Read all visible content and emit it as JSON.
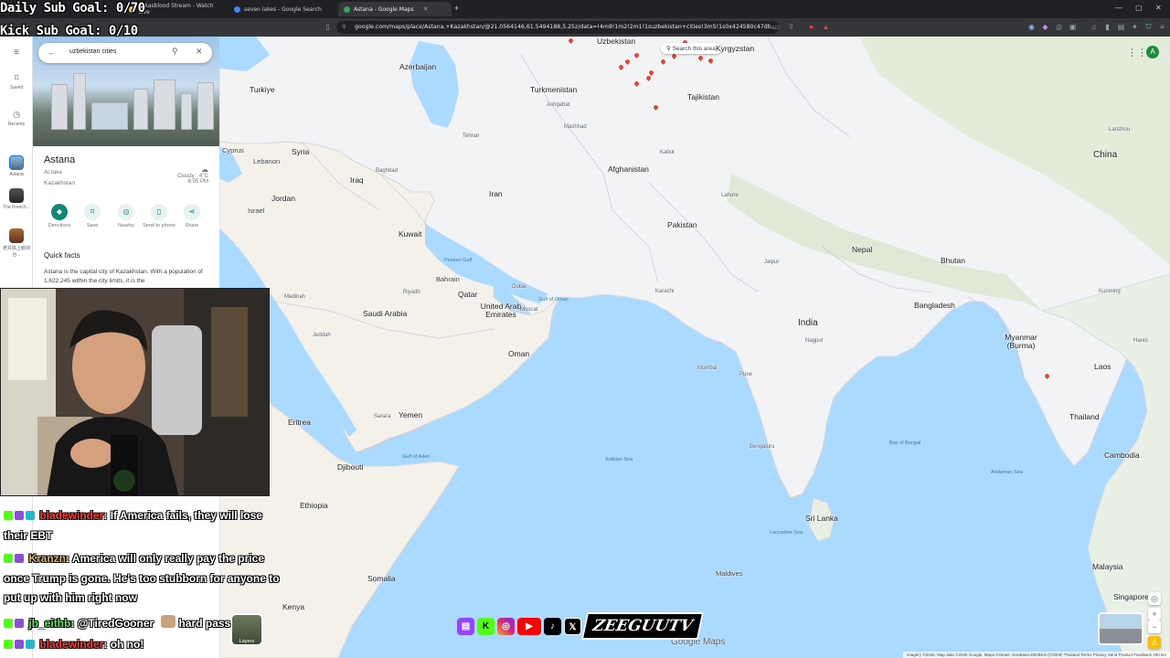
{
  "overlay": {
    "daily_goal": "Daily Sub Goal: 0/70",
    "kick_goal": "Kick Sub Goal: 0/10"
  },
  "browser": {
    "tabs": [
      {
        "label": "sukasblood Stream - Watch Live",
        "favicon": "#e9c34a"
      },
      {
        "label": "seven lakes - Google Search",
        "favicon": "#4285f4"
      },
      {
        "label": "Astana - Google Maps",
        "favicon": "#34a853",
        "active": true
      }
    ],
    "new_tab": "+",
    "url": "google.com/maps/place/Astana,+Kazakhstan/@21.0564146,61.5494188,5.25z/data=!4m9!1m2!2m1!1suzbekistan+cities!3m5!1s0x424580c47db..."
  },
  "rail": {
    "menu": "≡",
    "items": [
      {
        "label": "Saved",
        "icon": "bookmark-icon"
      },
      {
        "label": "Recents",
        "icon": "history-icon"
      },
      {
        "label": "Astana",
        "icon": "astana-thumb"
      },
      {
        "label": "The French...",
        "icon": "french-thumb"
      },
      {
        "label": "老井陈上鹅圳 台...",
        "icon": "recent-thumb"
      }
    ]
  },
  "search": {
    "query": "uzbekistan cities"
  },
  "place": {
    "title": "Astana",
    "native_name": "Астана",
    "country": "Kazakhstan",
    "weather_desc": "Cloudy · 4°C",
    "weather_time": "6:05 PM",
    "actions": [
      {
        "label": "Directions",
        "icon": "directions-icon"
      },
      {
        "label": "Save",
        "icon": "bookmark-icon"
      },
      {
        "label": "Nearby",
        "icon": "nearby-icon"
      },
      {
        "label": "Send to phone",
        "icon": "phone-icon"
      },
      {
        "label": "Share",
        "icon": "share-icon"
      }
    ],
    "quick_facts_title": "Quick facts",
    "quick_facts_text": "Astana is the capital city of Kazakhstan. With a population of 1,622,245 within the city limits, it is the"
  },
  "map": {
    "search_this_area": "Search this area",
    "google_logo": "Google Maps",
    "footer": "Imagery ©2026, Map data ©2026 Google, Mapa GISrael, GeoBasis-DE/BKG (©2009)   Thailand   Terms   Privacy   Send Product Feedback   200 km",
    "layers_label": "Layers",
    "account_initial": "A",
    "labels": {
      "uzbekistan": "Uzbekistan",
      "kyrgyzstan": "Kyrgyzstan",
      "azerbaijan": "Azerbaijan",
      "turkiye": "Turkiye",
      "turkmenistan": "Turkmenistan",
      "ashgabat": "Ashgabat",
      "tajikistan": "Tajikistan",
      "tehran": "Tehran",
      "mashhad": "Mashhad",
      "cyprus": "Cyprus",
      "syria": "Syria",
      "lebanon": "Lebanon",
      "baghdad": "Baghdad",
      "iraq": "Iraq",
      "afghanistan": "Afghanistan",
      "kabul": "Kabul",
      "jordan": "Jordan",
      "israel": "Israel",
      "iran": "Iran",
      "pakistan": "Pakistan",
      "kuwait": "Kuwait",
      "nepal": "Nepal",
      "bhutan": "Bhutan",
      "china": "China",
      "bahrain": "Bahrain",
      "qatar": "Qatar",
      "dubai": "Dubai",
      "riyadh": "Riyadh",
      "madinah": "Madinah",
      "karachi": "Karachi",
      "bangladesh": "Bangladesh",
      "saudi_arabia": "Saudi Arabia",
      "uae": "United Arab Emirates",
      "muscat": "Muscat",
      "india": "India",
      "myanmar": "Myanmar (Burma)",
      "jeddah": "Jeddah",
      "oman": "Oman",
      "laos": "Laos",
      "mumbai": "Mumbai",
      "pune": "Pune",
      "thailand": "Thailand",
      "eritrea": "Eritrea",
      "sanaa": "Sana'a",
      "yemen": "Yemen",
      "cambodia": "Cambodia",
      "djibouti": "Djibouti",
      "bengaluru": "Bengaluru",
      "ethiopia": "Ethiopia",
      "sri_lanka": "Sri Lanka",
      "somalia": "Somalia",
      "maldives": "Maldives",
      "malaysia": "Malaysia",
      "kenya": "Kenya",
      "singapore": "Singapore",
      "nagpur": "Nagpur",
      "jaipur": "Jaipur",
      "lahore": "Lahore",
      "lanzhou": "Lanzhou",
      "kunming": "Kunming",
      "hanoi": "Hanoi",
      "arabian_sea": "Arabian Sea",
      "bay_of_bengal": "Bay of Bengal",
      "persian_gulf": "Persian Gulf",
      "gulf_of_aden": "Gulf of Aden",
      "gulf_of_oman": "Gulf of Oman",
      "laccadive_sea": "Laccadive Sea",
      "andaman_sea": "Andaman Sea"
    }
  },
  "chat": [
    {
      "user": "bladewinder",
      "color": "#ff3b3b",
      "text": ": If America fails, they will lose",
      "cont": "their EBT"
    },
    {
      "user": "Kranzn",
      "color": "#d9b36b",
      "text": ": America will only really pay the price",
      "cont": "once Trump is gone. He's too stubborn for anyone to",
      "cont2": "put up with him right now"
    },
    {
      "user": "jb_eithb",
      "color": "#66e05a",
      "text": ": @TiredGooner",
      "tail": "hard pass"
    },
    {
      "user": "bladewinder",
      "color": "#ff3b3b",
      "text": ": oh no!"
    }
  ],
  "socials": {
    "brand": "ZEEGUUTV",
    "icons": [
      "twitch-icon",
      "kick-icon",
      "instagram-icon",
      "youtube-icon",
      "tiktok-icon",
      "x-icon"
    ]
  }
}
